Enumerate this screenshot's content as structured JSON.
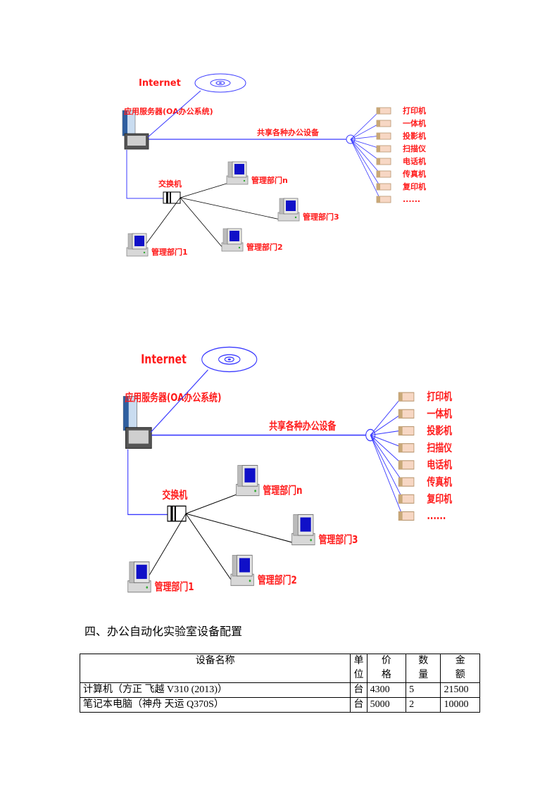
{
  "diagrams": [
    {
      "id": "diagram-small",
      "internet_label": "Internet",
      "server_label": "应用服务器(OA办公系统)",
      "shared_label": "共享各种办公设备",
      "switch_label": "交换机",
      "devices": [
        "打印机",
        "一体机",
        "投影机",
        "扫描仪",
        "电话机",
        "传真机",
        "复印机",
        "......"
      ],
      "departments": [
        "管理部门n",
        "管理部门3",
        "管理部门2",
        "管理部门1"
      ]
    },
    {
      "id": "diagram-large",
      "internet_label": "Internet",
      "server_label": "应用服务器(OA办公系统)",
      "shared_label": "共享各种办公设备",
      "switch_label": "交换机",
      "devices": [
        "打印机",
        "一体机",
        "投影机",
        "扫描仪",
        "电话机",
        "传真机",
        "复印机",
        "......"
      ],
      "departments": [
        "管理部门n",
        "管理部门3",
        "管理部门2",
        "管理部门1"
      ]
    }
  ],
  "colors": {
    "label_red": "#ff1a1a",
    "link_blue": "#3a3aff",
    "screen_blue": "#1010c8"
  },
  "section": {
    "title": "四、办公自动化实验室设备配置"
  },
  "table": {
    "headers": {
      "name": "设备名称",
      "unit": [
        "单",
        "位"
      ],
      "price": [
        "价",
        "格"
      ],
      "qty": [
        "数",
        "量"
      ],
      "amount": [
        "金",
        "额"
      ]
    },
    "rows": [
      {
        "name": "计算机（方正  飞越  V310 (2013)）",
        "unit": "台",
        "price": "4300",
        "qty": "5",
        "amount": "21500"
      },
      {
        "name": "笔记本电脑（神舟  天运  Q370S）",
        "unit": "台",
        "price": "5000",
        "qty": "2",
        "amount": "10000"
      }
    ]
  }
}
